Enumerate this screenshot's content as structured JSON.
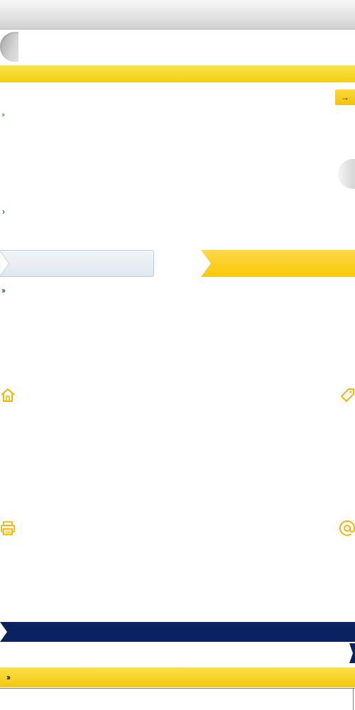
{
  "header": {
    "title": ""
  },
  "search": {
    "go_label": "→"
  },
  "links": {
    "chevron_double": "››",
    "chevron_single": "›"
  },
  "tabs": [
    {
      "label": ""
    },
    {
      "label": ""
    }
  ],
  "icons": {
    "home": "home-icon",
    "tag": "tag-icon",
    "print": "print-icon",
    "email": "at-sign-icon"
  },
  "footer": {
    "chevron_double": "››"
  },
  "colors": {
    "accent_yellow": "#f8c905",
    "navy": "#0b2260",
    "link_blue": "#0a2a66"
  }
}
